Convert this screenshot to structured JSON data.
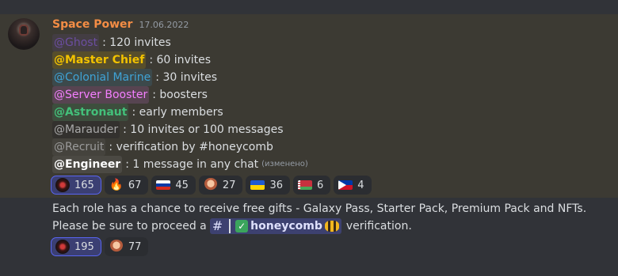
{
  "message1": {
    "author": "Space Power",
    "timestamp": "17.06.2022",
    "lines": [
      {
        "mention": "@Ghost",
        "text": ": 120 invites"
      },
      {
        "mention": "@Master Chief",
        "text": ": 60 invites"
      },
      {
        "mention": "@Colonial Marine",
        "text": ": 30 invites"
      },
      {
        "mention": "@Server Booster",
        "text": ": boosters"
      },
      {
        "mention": "@Astronaut",
        "text": ": early members"
      },
      {
        "mention": "@Marauder",
        "text": ": 10 invites or 100 messages"
      },
      {
        "mention": "@Recruit",
        "text": ": verification by #honeycomb"
      },
      {
        "mention": "@Engineer",
        "text": ": 1 message in any chat",
        "edited": "(изменено)"
      }
    ],
    "reactions": [
      {
        "icon": "server-emoji-icon",
        "count": "165",
        "active": true
      },
      {
        "icon": "fire-icon",
        "count": "67"
      },
      {
        "icon": "russia-flag-icon",
        "count": "45"
      },
      {
        "icon": "person-emoji-icon",
        "count": "27"
      },
      {
        "icon": "ukraine-flag-icon",
        "count": "36"
      },
      {
        "icon": "belarus-flag-icon",
        "count": "6"
      },
      {
        "icon": "philippines-flag-icon",
        "count": "4"
      }
    ]
  },
  "message2": {
    "line1": "Each role has a chance to receive free gifts - Galaxy Pass, Starter Pack, Premium Pack and NFTs.",
    "line2_prefix": "Please be sure to proceed a",
    "channel_hash": "#",
    "channel_name": "honeycomb",
    "line2_suffix": "verification.",
    "reactions": [
      {
        "icon": "server-emoji-icon",
        "count": "195",
        "active": true
      },
      {
        "icon": "person-emoji-icon",
        "count": "77"
      }
    ]
  },
  "colors": {
    "highlight_bg": "#3c3a33",
    "chat_bg": "#313338",
    "author": "#f48d45",
    "blurple": "#5865f2"
  }
}
